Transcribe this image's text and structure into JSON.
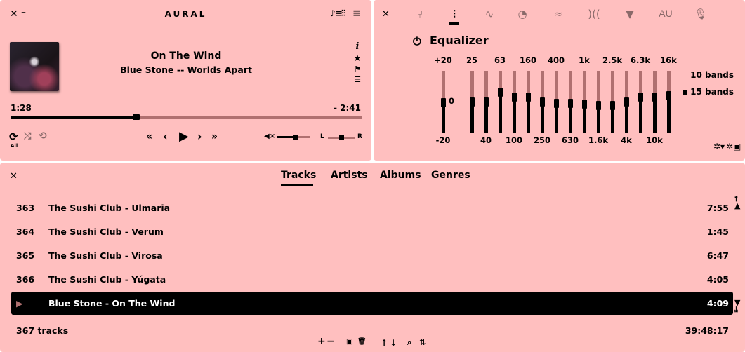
{
  "player": {
    "app_name": "AURAL",
    "track_title": "On The Wind",
    "track_subtitle": "Blue Stone -- Worlds Apart",
    "elapsed": "1:28",
    "remaining": "- 2:41",
    "progress_fraction": 0.355,
    "repeat_mode_label": "All",
    "volume_fraction": 0.55,
    "balance_fraction": 0.5,
    "balance_left": "L",
    "balance_right": "R",
    "icons": {
      "close": "✕",
      "minimize": "–",
      "playlist": "♫",
      "effects": "⫶",
      "menu": "≡",
      "info": "i",
      "favorite": "★",
      "bookmark": "⚑",
      "chapters": "☰",
      "repeat": "⟳",
      "shuffle": "⤮",
      "loop": "⟲",
      "seek_back_long": "«",
      "previous": "‹",
      "play": "▶",
      "next": "›",
      "seek_fwd_long": "»",
      "mute": "🔇"
    }
  },
  "effects": {
    "close_icon": "✕",
    "tabs": [
      {
        "name": "master",
        "glyph": "⑂",
        "active": false
      },
      {
        "name": "equalizer",
        "glyph": "⫶",
        "active": true
      },
      {
        "name": "pitch",
        "glyph": "∿",
        "active": false
      },
      {
        "name": "time",
        "glyph": "◔",
        "active": false
      },
      {
        "name": "reverb",
        "glyph": "≈",
        "active": false
      },
      {
        "name": "delay",
        "glyph": ")((",
        "active": false
      },
      {
        "name": "filter",
        "glyph": "▼",
        "active": false
      },
      {
        "name": "audio-units",
        "glyph": "AU",
        "active": false
      },
      {
        "name": "recorder",
        "glyph": "🎙",
        "active": false
      }
    ],
    "title": "Equalizer",
    "power_icon": "⏻",
    "scale": {
      "top": "+20",
      "zero": "0",
      "bottom": "-20"
    },
    "preamp_db": -0.5,
    "bands": [
      {
        "label": "25",
        "db": 0
      },
      {
        "label": "40",
        "db": 0
      },
      {
        "label": "63",
        "db": 6
      },
      {
        "label": "100",
        "db": 3
      },
      {
        "label": "160",
        "db": 3
      },
      {
        "label": "250",
        "db": 0
      },
      {
        "label": "400",
        "db": -1
      },
      {
        "label": "630",
        "db": -1
      },
      {
        "label": "1k",
        "db": -1.5
      },
      {
        "label": "1.6k",
        "db": -2.5
      },
      {
        "label": "2.5k",
        "db": -2.5
      },
      {
        "label": "4k",
        "db": 0
      },
      {
        "label": "6.3k",
        "db": 3
      },
      {
        "label": "10k",
        "db": 3
      },
      {
        "label": "16k",
        "db": 4
      }
    ],
    "band_options": [
      {
        "label": "10 bands",
        "selected": false
      },
      {
        "label": "15 bands",
        "selected": true
      }
    ],
    "preset_icons": {
      "load": "⚙",
      "save": "⚙"
    }
  },
  "playlist": {
    "close_icon": "✕",
    "tabs": [
      {
        "label": "Tracks",
        "active": true
      },
      {
        "label": "Artists",
        "active": false
      },
      {
        "label": "Albums",
        "active": false
      },
      {
        "label": "Genres",
        "active": false
      }
    ],
    "rows": [
      {
        "num": "363",
        "name": "The Sushi Club - Ulmaria",
        "duration": "7:55",
        "selected": false
      },
      {
        "num": "364",
        "name": "The Sushi Club - Verum",
        "duration": "1:45",
        "selected": false
      },
      {
        "num": "365",
        "name": "The Sushi Club - Virosa",
        "duration": "6:47",
        "selected": false
      },
      {
        "num": "366",
        "name": "The Sushi Club - Yúgata",
        "duration": "4:05",
        "selected": false
      },
      {
        "num": "▶",
        "name": "Blue Stone - On The Wind",
        "duration": "4:09",
        "selected": true
      }
    ],
    "track_count": "367 tracks",
    "total_duration": "39:48:17",
    "footer_icons": {
      "add": "+",
      "remove": "−",
      "save": "💾",
      "clear": "🗑",
      "move_up": "↑",
      "move_down": "↓",
      "search": "🔍",
      "sort": "⇅"
    },
    "scroll_icons": {
      "top": "⤒",
      "up": "▲",
      "down": "▼",
      "bottom": "⤓"
    }
  },
  "colors": {
    "panel_bg": "#ffbfbf",
    "track_inactive": "#b07070",
    "accent": "#000000",
    "selection": "#000000"
  }
}
